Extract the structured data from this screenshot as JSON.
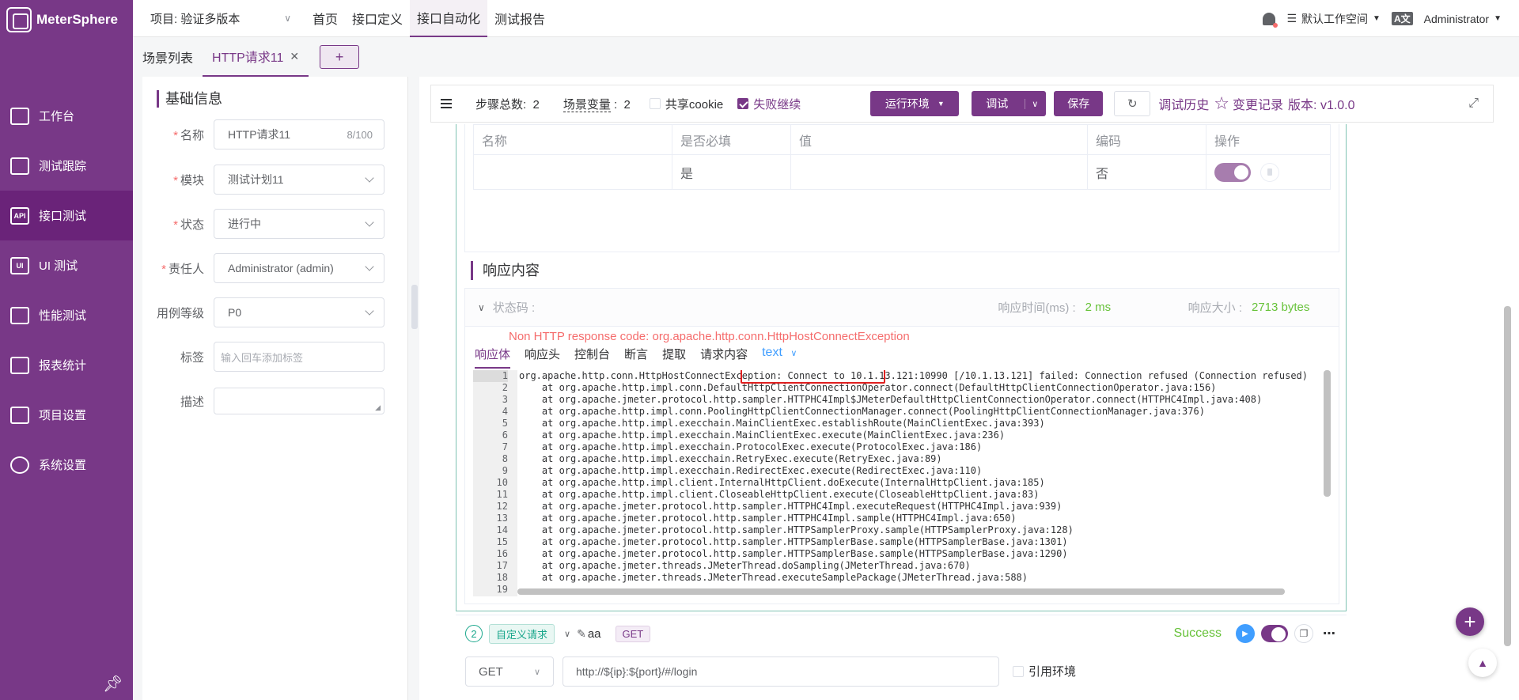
{
  "app": {
    "name": "MeterSphere"
  },
  "sidebar": {
    "items": [
      {
        "label": "工作台",
        "icon": "monitor-icon"
      },
      {
        "label": "测试跟踪",
        "icon": "clipboard-icon"
      },
      {
        "label": "接口测试",
        "icon": "api-icon",
        "active": true
      },
      {
        "label": "UI 测试",
        "icon": "ui-icon"
      },
      {
        "label": "性能测试",
        "icon": "chart-icon"
      },
      {
        "label": "报表统计",
        "icon": "report-icon"
      },
      {
        "label": "项目设置",
        "icon": "folder-icon"
      },
      {
        "label": "系统设置",
        "icon": "gear-icon"
      }
    ]
  },
  "topbar": {
    "project": "项目: 验证多版本",
    "nav": [
      "首页",
      "接口定义",
      "接口自动化",
      "测试报告"
    ],
    "active_nav": "接口自动化",
    "workspace": "默认工作空间",
    "user": "Administrator"
  },
  "tabs": {
    "list_label": "场景列表",
    "active_label": "HTTP请求11",
    "add_label": "+"
  },
  "basic_info": {
    "title": "基础信息",
    "name_label": "名称",
    "name_value": "HTTP请求11",
    "name_count": "8/100",
    "module_label": "模块",
    "module_value": "测试计划11",
    "status_label": "状态",
    "status_value": "进行中",
    "owner_label": "责任人",
    "owner_value": "Administrator (admin)",
    "level_label": "用例等级",
    "level_value": "P0",
    "tag_label": "标签",
    "tag_placeholder": "输入回车添加标签",
    "desc_label": "描述"
  },
  "toolbar": {
    "steps_label": "步骤总数:",
    "steps_value": "2",
    "vars_label": "场景变量",
    "vars_value": "2",
    "share_cookie": "共享cookie",
    "fail_continue": "失败继续",
    "env_button": "运行环境",
    "debug_button": "调试",
    "save_button": "保存",
    "history": "调试历史",
    "changelog": "变更记录",
    "version": "版本: v1.0.0"
  },
  "param_table": {
    "headers": [
      "名称",
      "是否必填",
      "值",
      "编码",
      "操作"
    ],
    "row": {
      "required": "是",
      "encode": "否"
    }
  },
  "response": {
    "title": "响应内容",
    "status_label": "状态码 :",
    "time_label": "响应时间(ms) :",
    "time_value": "2 ms",
    "size_label": "响应大小 :",
    "size_value": "2713 bytes",
    "error": "Non HTTP response code: org.apache.http.conn.HttpHostConnectException",
    "tabs": [
      "响应体",
      "响应头",
      "控制台",
      "断言",
      "提取",
      "请求内容"
    ],
    "format": "text",
    "lines": [
      "org.apache.http.conn.HttpHostConnectException: Connect to 10.1.13.121:10990 [/10.1.13.121] failed: Connection refused (Connection refused)",
      "    at org.apache.http.impl.conn.DefaultHttpClientConnectionOperator.connect(DefaultHttpClientConnectionOperator.java:156)",
      "    at org.apache.jmeter.protocol.http.sampler.HTTPHC4Impl$JMeterDefaultHttpClientConnectionOperator.connect(HTTPHC4Impl.java:408)",
      "    at org.apache.http.impl.conn.PoolingHttpClientConnectionManager.connect(PoolingHttpClientConnectionManager.java:376)",
      "    at org.apache.http.impl.execchain.MainClientExec.establishRoute(MainClientExec.java:393)",
      "    at org.apache.http.impl.execchain.MainClientExec.execute(MainClientExec.java:236)",
      "    at org.apache.http.impl.execchain.ProtocolExec.execute(ProtocolExec.java:186)",
      "    at org.apache.http.impl.execchain.RetryExec.execute(RetryExec.java:89)",
      "    at org.apache.http.impl.execchain.RedirectExec.execute(RedirectExec.java:110)",
      "    at org.apache.http.impl.client.InternalHttpClient.doExecute(InternalHttpClient.java:185)",
      "    at org.apache.http.impl.client.CloseableHttpClient.execute(CloseableHttpClient.java:83)",
      "    at org.apache.jmeter.protocol.http.sampler.HTTPHC4Impl.executeRequest(HTTPHC4Impl.java:939)",
      "    at org.apache.jmeter.protocol.http.sampler.HTTPHC4Impl.sample(HTTPHC4Impl.java:650)",
      "    at org.apache.jmeter.protocol.http.sampler.HTTPSamplerProxy.sample(HTTPSamplerProxy.java:128)",
      "    at org.apache.jmeter.protocol.http.sampler.HTTPSamplerBase.sample(HTTPSamplerBase.java:1301)",
      "    at org.apache.jmeter.protocol.http.sampler.HTTPSamplerBase.sample(HTTPSamplerBase.java:1290)",
      "    at org.apache.jmeter.threads.JMeterThread.doSampling(JMeterThread.java:670)",
      "    at org.apache.jmeter.threads.JMeterThread.executeSamplePackage(JMeterThread.java:588)",
      ""
    ]
  },
  "step2": {
    "number": "2",
    "type_tag": "自定义请求",
    "name": "aa",
    "method_tag": "GET",
    "status": "Success",
    "method": "GET",
    "url": "http://${ip}:${port}/#/login",
    "use_env": "引用环境"
  }
}
